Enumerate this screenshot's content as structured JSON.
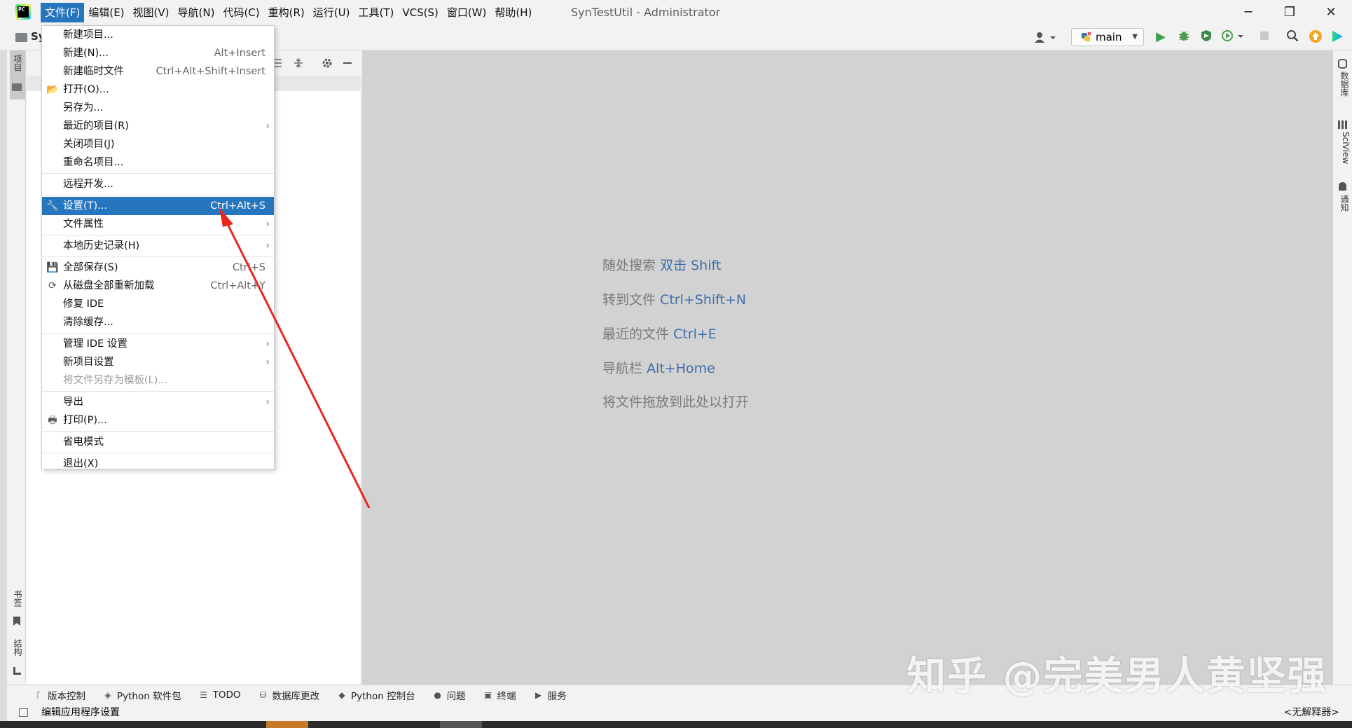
{
  "menubar": {
    "items": [
      "文件(F)",
      "编辑(E)",
      "视图(V)",
      "导航(N)",
      "代码(C)",
      "重构(R)",
      "运行(U)",
      "工具(T)",
      "VCS(S)",
      "窗口(W)",
      "帮助(H)"
    ],
    "active_index": 0
  },
  "window": {
    "title": "SynTestUtil - Administrator",
    "minimize": "─",
    "restore": "❐",
    "close": "✕"
  },
  "breadcrumb": {
    "text": "Sy"
  },
  "toolbar": {
    "branch": "main"
  },
  "file_menu": {
    "items": [
      {
        "label": "新建项目...",
        "shortcut": ""
      },
      {
        "label": "新建(N)...",
        "shortcut": "Alt+Insert"
      },
      {
        "label": "新建临时文件",
        "shortcut": "Ctrl+Alt+Shift+Insert"
      },
      {
        "label": "打开(O)...",
        "shortcut": ""
      },
      {
        "label": "另存为...",
        "shortcut": ""
      },
      {
        "label": "最近的项目(R)",
        "shortcut": ""
      },
      {
        "label": "关闭项目(J)",
        "shortcut": ""
      },
      {
        "label": "重命名项目...",
        "shortcut": ""
      },
      {
        "label": "远程开发...",
        "shortcut": ""
      },
      {
        "label": "设置(T)...",
        "shortcut": "Ctrl+Alt+S"
      },
      {
        "label": "文件属性",
        "shortcut": ""
      },
      {
        "label": "本地历史记录(H)",
        "shortcut": ""
      },
      {
        "label": "全部保存(S)",
        "shortcut": "Ctrl+S"
      },
      {
        "label": "从磁盘全部重新加载",
        "shortcut": "Ctrl+Alt+Y"
      },
      {
        "label": "修复 IDE",
        "shortcut": ""
      },
      {
        "label": "清除缓存...",
        "shortcut": ""
      },
      {
        "label": "管理 IDE 设置",
        "shortcut": ""
      },
      {
        "label": "新项目设置",
        "shortcut": ""
      },
      {
        "label": "将文件另存为模板(L)...",
        "shortcut": ""
      },
      {
        "label": "导出",
        "shortcut": ""
      },
      {
        "label": "打印(P)...",
        "shortcut": ""
      },
      {
        "label": "省电模式",
        "shortcut": ""
      },
      {
        "label": "退出(X)",
        "shortcut": ""
      }
    ],
    "selected_index": 9,
    "disabled_index": 18,
    "submenu_arrow": "›"
  },
  "editor_hints": [
    {
      "text": "随处搜索",
      "key": "双击 Shift"
    },
    {
      "text": "转到文件",
      "key": "Ctrl+Shift+N"
    },
    {
      "text": "最近的文件",
      "key": "Ctrl+E"
    },
    {
      "text": "导航栏",
      "key": "Alt+Home"
    },
    {
      "text": "将文件拖放到此处以打开",
      "key": ""
    }
  ],
  "left_tabs": {
    "project": "项目",
    "bookmarks": "书签",
    "structure": "结构"
  },
  "right_tabs": {
    "database": "数据库",
    "sciview": "SciView",
    "notifications": "通知"
  },
  "bottom_tools": [
    {
      "label": "版本控制",
      "icon": "version-control-icon"
    },
    {
      "label": "Python 软件包",
      "icon": "python-packages-icon"
    },
    {
      "label": "TODO",
      "icon": "todo-icon"
    },
    {
      "label": "数据库更改",
      "icon": "database-changes-icon"
    },
    {
      "label": "Python 控制台",
      "icon": "python-console-icon"
    },
    {
      "label": "问题",
      "icon": "problems-icon"
    },
    {
      "label": "终端",
      "icon": "terminal-icon"
    },
    {
      "label": "服务",
      "icon": "services-icon"
    }
  ],
  "statusbar": {
    "text": "编辑应用程序设置",
    "interpreter": "<无解释器>"
  },
  "watermark": "知乎 @完美男人黄坚强",
  "colors": {
    "accent": "#2675bf",
    "editor_bg": "#d2d2d2",
    "hint_key": "#3f6ea8",
    "annotation_arrow": "#e8281e"
  }
}
